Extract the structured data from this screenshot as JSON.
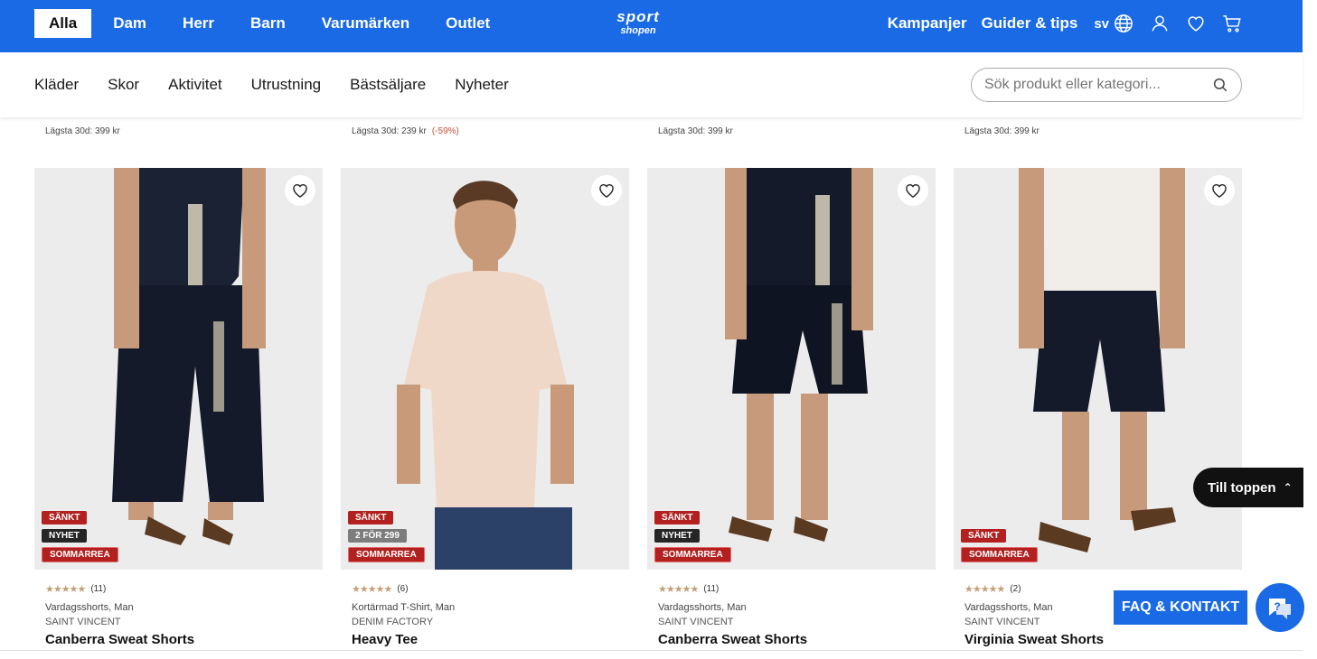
{
  "header": {
    "tabs": [
      {
        "label": "Alla",
        "active": true
      },
      {
        "label": "Dam"
      },
      {
        "label": "Herr"
      },
      {
        "label": "Barn"
      },
      {
        "label": "Varumärken"
      },
      {
        "label": "Outlet"
      }
    ],
    "logo_line1": "sport",
    "logo_line2": "shopen",
    "links": [
      "Kampanjer",
      "Guider & tips"
    ],
    "language": "sv",
    "icons": [
      "globe-icon",
      "user-icon",
      "heart-icon",
      "cart-icon"
    ]
  },
  "categories": [
    "Kläder",
    "Skor",
    "Aktivitet",
    "Utrustning",
    "Bästsäljare",
    "Nyheter"
  ],
  "search": {
    "placeholder": "Sök produkt eller kategori..."
  },
  "prev_prices": [
    {
      "text": "Lägsta 30d: 399 kr",
      "discount": ""
    },
    {
      "text": "Lägsta 30d: 239 kr",
      "discount": "(-59%)"
    },
    {
      "text": "Lägsta 30d: 399 kr",
      "discount": ""
    },
    {
      "text": "Lägsta 30d: 399 kr",
      "discount": ""
    }
  ],
  "products": [
    {
      "badges": [
        {
          "label": "SÄNKT",
          "kind": "sankt"
        },
        {
          "label": "NYHET",
          "kind": "nyhet"
        },
        {
          "label": "SOMMARREA",
          "kind": "somm"
        }
      ],
      "stars": "★★★★★",
      "reviews": "(11)",
      "type": "Vardagsshorts, Man",
      "brand": "SAINT VINCENT",
      "name": "Canberra Sweat Shorts"
    },
    {
      "badges": [
        {
          "label": "SÄNKT",
          "kind": "sankt"
        },
        {
          "label": "2 FÖR 299",
          "kind": "2for"
        },
        {
          "label": "SOMMARREA",
          "kind": "somm"
        }
      ],
      "stars": "★★★★★",
      "reviews": "(6)",
      "type": "Kortärmad T-Shirt, Man",
      "brand": "DENIM FACTORY",
      "name": "Heavy Tee"
    },
    {
      "badges": [
        {
          "label": "SÄNKT",
          "kind": "sankt"
        },
        {
          "label": "NYHET",
          "kind": "nyhet"
        },
        {
          "label": "SOMMARREA",
          "kind": "somm"
        }
      ],
      "stars": "★★★★★",
      "reviews": "(11)",
      "type": "Vardagsshorts, Man",
      "brand": "SAINT VINCENT",
      "name": "Canberra Sweat Shorts"
    },
    {
      "badges": [
        {
          "label": "SÄNKT",
          "kind": "sankt"
        },
        {
          "label": "SOMMARREA",
          "kind": "somm"
        }
      ],
      "stars": "★★★★★",
      "reviews": "(2)",
      "type": "Vardagsshorts, Man",
      "brand": "SAINT VINCENT",
      "name": "Virginia Sweat Shorts"
    }
  ],
  "widgets": {
    "to_top": "Till toppen",
    "faq": "FAQ & KONTAKT",
    "chat_icon": "chat-help-icon"
  },
  "colors": {
    "brand_blue": "#1a6ae6",
    "sale_red": "#b32020"
  }
}
